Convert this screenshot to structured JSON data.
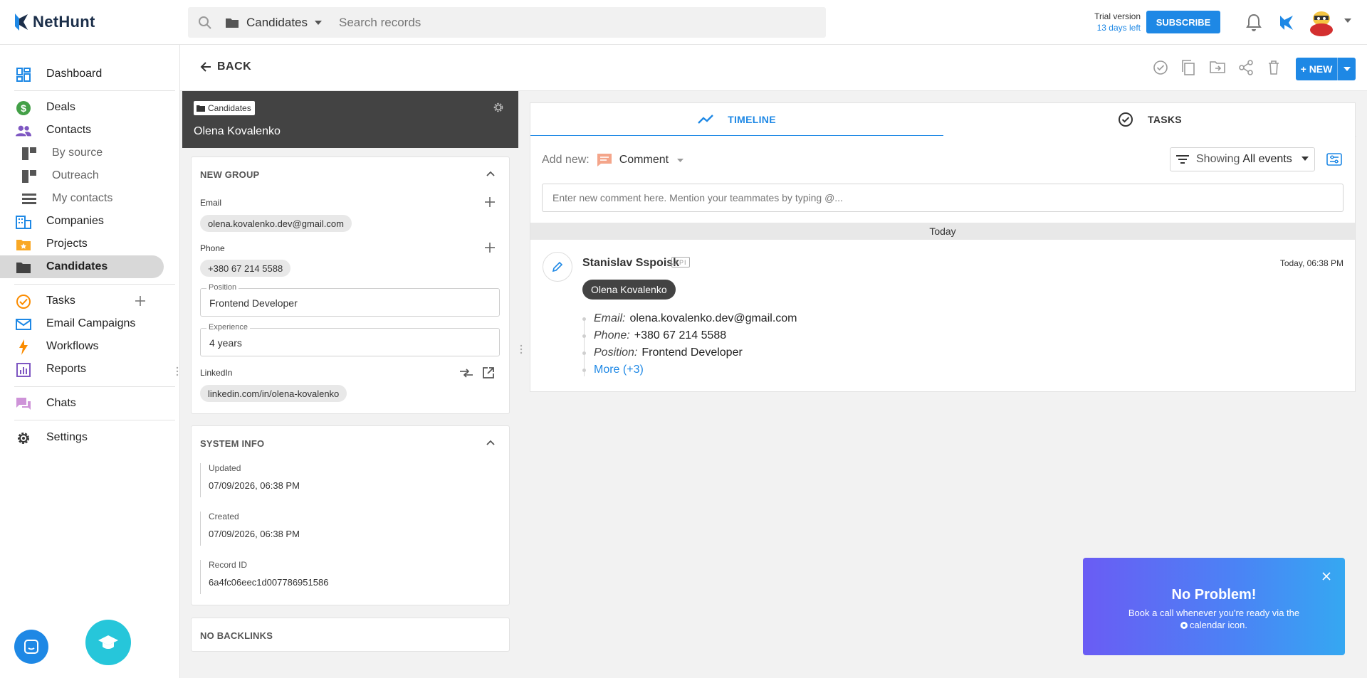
{
  "app": {
    "brand": "NetHunt",
    "colors": {
      "accent": "#1e88e5",
      "record_header": "#434343",
      "active_nav": "#d8d8d8"
    }
  },
  "topbar": {
    "search_scope": "Candidates",
    "search_placeholder": "Search records",
    "trial_line1": "Trial version",
    "trial_line2": "13 days left",
    "subscribe_label": "SUBSCRIBE"
  },
  "sidebar": {
    "items": [
      {
        "label": "Dashboard",
        "icon": "dashboard-icon"
      },
      {
        "label": "Deals",
        "icon": "dollar-icon"
      },
      {
        "label": "Contacts",
        "icon": "people-icon"
      },
      {
        "label": "By source",
        "icon": "view-icon"
      },
      {
        "label": "Outreach",
        "icon": "view-icon"
      },
      {
        "label": "My contacts",
        "icon": "list-icon"
      },
      {
        "label": "Companies",
        "icon": "building-icon"
      },
      {
        "label": "Projects",
        "icon": "star-folder-icon"
      },
      {
        "label": "Candidates",
        "icon": "folder-icon"
      },
      {
        "label": "Tasks",
        "icon": "check-circle-icon"
      },
      {
        "label": "Email Campaigns",
        "icon": "email-icon"
      },
      {
        "label": "Workflows",
        "icon": "bolt-icon"
      },
      {
        "label": "Reports",
        "icon": "chart-icon"
      },
      {
        "label": "Chats",
        "icon": "chat-icon"
      },
      {
        "label": "Settings",
        "icon": "gear-icon"
      }
    ]
  },
  "header": {
    "back_label": "BACK",
    "new_label": "+ NEW"
  },
  "record": {
    "folder_tag": "Candidates",
    "name": "Olena Kovalenko",
    "group_title": "NEW GROUP",
    "email_label": "Email",
    "email_value": "olena.kovalenko.dev@gmail.com",
    "phone_label": "Phone",
    "phone_value": "+380 67 214 5588",
    "position_label": "Position",
    "position_value": "Frontend Developer",
    "experience_label": "Experience",
    "experience_value": "4 years",
    "linkedin_label": "LinkedIn",
    "linkedin_value": "linkedin.com/in/olena-kovalenko",
    "system_title": "SYSTEM INFO",
    "updated_label": "Updated",
    "updated_value": "07/09/2026, 06:38 PM",
    "created_label": "Created",
    "created_value": "07/09/2026, 06:38 PM",
    "record_id_label": "Record ID",
    "record_id_value": "6a4fc06eec1d007786951586",
    "backlinks_title": "NO BACKLINKS"
  },
  "timeline": {
    "tab_timeline": "TIMELINE",
    "tab_tasks": "TASKS",
    "add_new_label": "Add new:",
    "add_new_type": "Comment",
    "showing_label": "Showing",
    "showing_value": "All events",
    "comment_placeholder": "Enter new comment here. Mention your teammates by typing @...",
    "day_label": "Today",
    "event": {
      "author": "Stanislav Sspoisk",
      "badge": "API",
      "time": "Today, 06:38 PM",
      "record_chip": "Olena Kovalenko",
      "fields": [
        {
          "key": "Email:",
          "value": "olena.kovalenko.dev@gmail.com"
        },
        {
          "key": "Phone:",
          "value": "+380 67 214 5588"
        },
        {
          "key": "Position:",
          "value": "Frontend Developer"
        }
      ],
      "more_label": "More (+3)"
    }
  },
  "toast": {
    "title": "No Problem!",
    "body_line1": "Book a call whenever you're ready via the",
    "body_line2": "calendar icon."
  }
}
